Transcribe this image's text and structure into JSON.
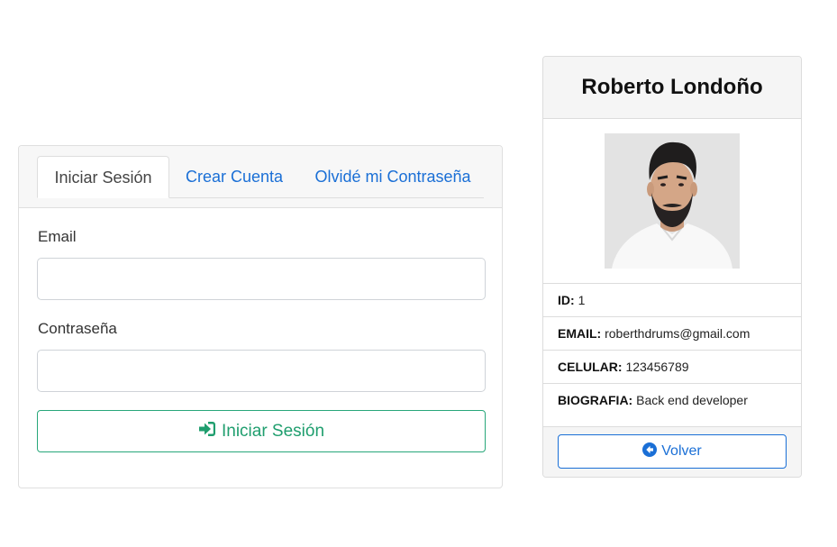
{
  "login": {
    "tabs": [
      {
        "label": "Iniciar Sesión",
        "active": true
      },
      {
        "label": "Crear Cuenta",
        "active": false
      },
      {
        "label": "Olvidé mi Contraseña",
        "active": false
      }
    ],
    "email_label": "Email",
    "email_value": "",
    "password_label": "Contraseña",
    "password_value": "",
    "submit_label": "Iniciar Sesión",
    "submit_icon": "sign-in-icon"
  },
  "profile": {
    "name": "Roberto Londoño",
    "rows": [
      {
        "label": "ID:",
        "value": "1"
      },
      {
        "label": "EMAIL:",
        "value": "roberthdrums@gmail.com"
      },
      {
        "label": "CELULAR:",
        "value": "123456789"
      },
      {
        "label": "BIOGRAFIA:",
        "value": "Back end developer"
      }
    ],
    "back_label": "Volver",
    "back_icon": "arrow-circle-left-icon"
  },
  "colors": {
    "link": "#1a6fd6",
    "success": "#28a77a",
    "header_bg": "#f7f7f7"
  }
}
